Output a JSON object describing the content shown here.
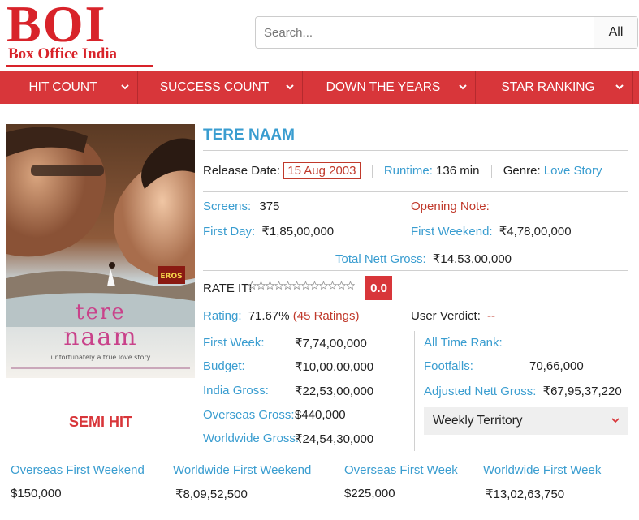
{
  "brand": {
    "logo_big": "BOI",
    "logo_small": "Box Office India",
    "color": "#d8232a"
  },
  "search": {
    "placeholder": "Search...",
    "category": "All"
  },
  "nav": {
    "items": [
      {
        "label": "HIT COUNT"
      },
      {
        "label": "SUCCESS COUNT"
      },
      {
        "label": "DOWN THE YEARS"
      },
      {
        "label": "STAR RANKING"
      }
    ]
  },
  "poster": {
    "title_line1": "tere",
    "title_line2": "naam",
    "tagline": "unfortunately a true love story",
    "stamp": "EROS"
  },
  "movie": {
    "title": "TERE NAAM",
    "release_label": "Release Date:",
    "release_date": "15 Aug 2003",
    "runtime_label": "Runtime:",
    "runtime": "136 min",
    "genre_label": "Genre:",
    "genre": "Love Story",
    "screens_label": "Screens:",
    "screens": "375",
    "opening_label": "Opening Note:",
    "first_day_label": "First Day:",
    "first_day": "₹1,85,00,000",
    "first_weekend_label": "First Weekend:",
    "first_weekend": "₹4,78,00,000",
    "total_nett_label": "Total Nett Gross:",
    "total_nett": "₹14,53,00,000",
    "rate_label": "RATE IT!",
    "rate_score": "0.0",
    "rating_label": "Rating:",
    "rating": "71.67%",
    "rating_count": "(45 Ratings)",
    "user_verdict_label": "User Verdict:",
    "user_verdict": "--",
    "verdict": "SEMI HIT"
  },
  "figures": {
    "first_week_label": "First Week:",
    "first_week": "₹7,74,00,000",
    "budget_label": "Budget:",
    "budget": "₹10,00,00,000",
    "india_gross_label": "India Gross:",
    "india_gross": "₹22,53,00,000",
    "overseas_gross_label": "Overseas Gross:",
    "overseas_gross": "$440,000",
    "worldwide_gross_label": "Worldwide Gross:",
    "worldwide_gross": "₹24,54,30,000",
    "all_time_rank_label": "All Time Rank:",
    "footfalls_label": "Footfalls:",
    "footfalls": "70,66,000",
    "adjusted_label": "Adjusted Nett Gross:",
    "adjusted": "₹67,95,37,220",
    "territory_select": "Weekly Territory"
  },
  "bottom": [
    {
      "label": "Overseas First Weekend",
      "value": "$150,000"
    },
    {
      "label": "Worldwide First Weekend",
      "value": "₹8,09,52,500"
    },
    {
      "label": "Overseas First Week",
      "value": "$225,000"
    },
    {
      "label": "Worldwide First Week",
      "value": "₹13,02,63,750"
    }
  ],
  "colors": {
    "accent_red": "#d8363a",
    "link_blue": "#3a9dd0",
    "text_red": "#c0392b"
  }
}
